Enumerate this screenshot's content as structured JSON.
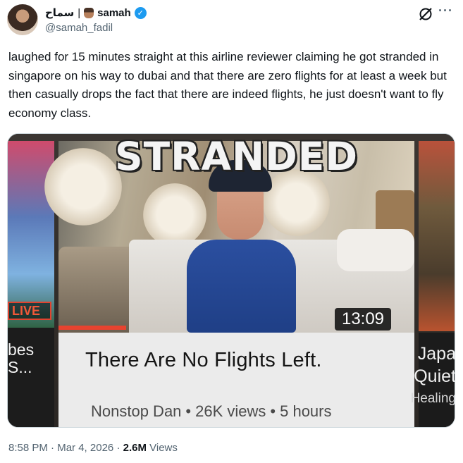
{
  "author": {
    "display_name_arabic": "سماح",
    "separator": "|",
    "display_name": "samah",
    "handle": "@samah_fadil"
  },
  "icons": {
    "verified": "verified-badge-icon",
    "grok": "grok-icon",
    "more": "more-icon"
  },
  "colors": {
    "verified": "#1d9bf0",
    "live_badge": "#f25838",
    "progress": "#e8432f"
  },
  "tweet_text": "laughed for 15 minutes straight at this airline reviewer claiming he got stranded in singapore on his way to dubai and that there are zero flights for at least a week but then casually drops the fact that there are indeed flights, he just doesn't want to fly economy class.",
  "media": {
    "thumbnail_overlay_text": "STRANDED",
    "duration": "13:09",
    "progress_fraction": 0.19,
    "video_title": "There Are No Flights Left.",
    "channel": "Nonstop Dan",
    "views": "26K views",
    "age": "5 hours",
    "left_card": {
      "live_label": "LIVE",
      "title_line1": "bes",
      "title_line2": "S..."
    },
    "right_card": {
      "line1": "Japa",
      "line2": "Quiet",
      "line3": "Healing"
    }
  },
  "footer": {
    "time": "8:58 PM",
    "date": "Mar 4, 2026",
    "views_count": "2.6M",
    "views_label": "Views"
  }
}
